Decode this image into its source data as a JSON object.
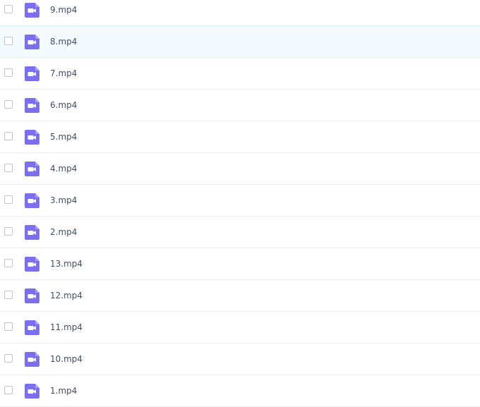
{
  "colors": {
    "icon_fill": "#7b6ff0",
    "hover_background": "#f3fbfe",
    "text": "#424e67"
  },
  "file_list": {
    "hovered_index": 1,
    "items": [
      {
        "name": "9.mp4",
        "icon": "video-file-icon"
      },
      {
        "name": "8.mp4",
        "icon": "video-file-icon"
      },
      {
        "name": "7.mp4",
        "icon": "video-file-icon"
      },
      {
        "name": "6.mp4",
        "icon": "video-file-icon"
      },
      {
        "name": "5.mp4",
        "icon": "video-file-icon"
      },
      {
        "name": "4.mp4",
        "icon": "video-file-icon"
      },
      {
        "name": "3.mp4",
        "icon": "video-file-icon"
      },
      {
        "name": "2.mp4",
        "icon": "video-file-icon"
      },
      {
        "name": "13.mp4",
        "icon": "video-file-icon"
      },
      {
        "name": "12.mp4",
        "icon": "video-file-icon"
      },
      {
        "name": "11.mp4",
        "icon": "video-file-icon"
      },
      {
        "name": "10.mp4",
        "icon": "video-file-icon"
      },
      {
        "name": "1.mp4",
        "icon": "video-file-icon"
      }
    ]
  }
}
